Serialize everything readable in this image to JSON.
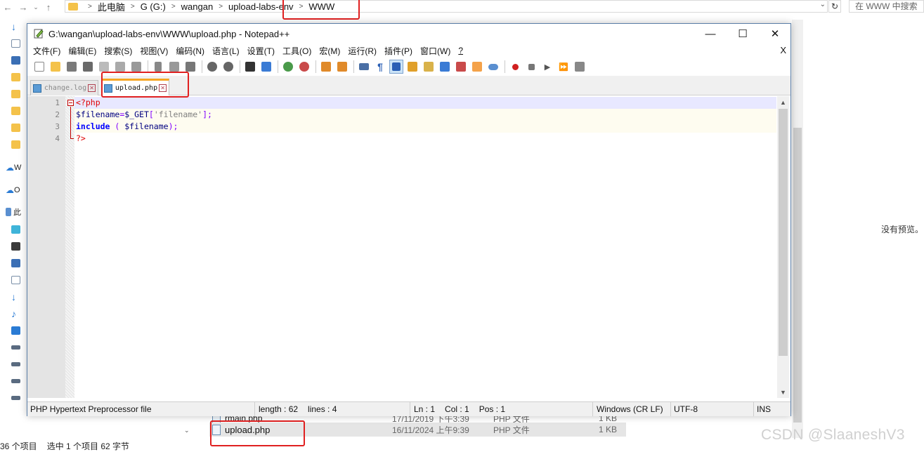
{
  "explorer": {
    "breadcrumbs": [
      "此电脑",
      "G (G:)",
      "wangan",
      "upload-labs-env",
      "WWW"
    ],
    "search_placeholder": "在 WWW 中搜索",
    "no_preview": "没有预览。",
    "side_labels": [
      "W",
      "O",
      "此"
    ],
    "files": [
      {
        "name": "rmain.php",
        "date": "17/11/2019 下午3:39",
        "type": "PHP 文件",
        "size": "1 KB"
      },
      {
        "name": "upload.php",
        "date": "16/11/2024 上午9:39",
        "type": "PHP 文件",
        "size": "1 KB"
      }
    ],
    "status": {
      "count": "36 个项目",
      "selected": "选中 1 个项目  62 字节"
    }
  },
  "watermark": "CSDN @SlaaneshV3",
  "npp": {
    "title": "G:\\wangan\\upload-labs-env\\WWW\\upload.php - Notepad++",
    "menu": [
      "文件(F)",
      "编辑(E)",
      "搜索(S)",
      "视图(V)",
      "编码(N)",
      "语言(L)",
      "设置(T)",
      "工具(O)",
      "宏(M)",
      "运行(R)",
      "插件(P)",
      "窗口(W)",
      "?"
    ],
    "menu_close": "X",
    "tabs": [
      {
        "label": "change.log",
        "active": false
      },
      {
        "label": "upload.php",
        "active": true
      }
    ],
    "line_numbers": [
      "1",
      "2",
      "3",
      "4"
    ],
    "code": {
      "l1_open": "<?php",
      "l2_var": "$filename",
      "l2_eq": "=",
      "l2_get": "$_GET",
      "l2_lb": "[",
      "l2_str": "'filename'",
      "l2_rb": "];",
      "l3_kw": "include",
      "l3_open": " ( ",
      "l3_var": "$filename",
      "l3_close": ");",
      "l4_close": "?>"
    },
    "status": {
      "filetype": "PHP Hypertext Preprocessor file",
      "length": "length : 62",
      "lines": "lines : 4",
      "ln": "Ln : 1",
      "col": "Col : 1",
      "pos": "Pos : 1",
      "eol": "Windows (CR LF)",
      "encoding": "UTF-8",
      "mode": "INS"
    }
  }
}
